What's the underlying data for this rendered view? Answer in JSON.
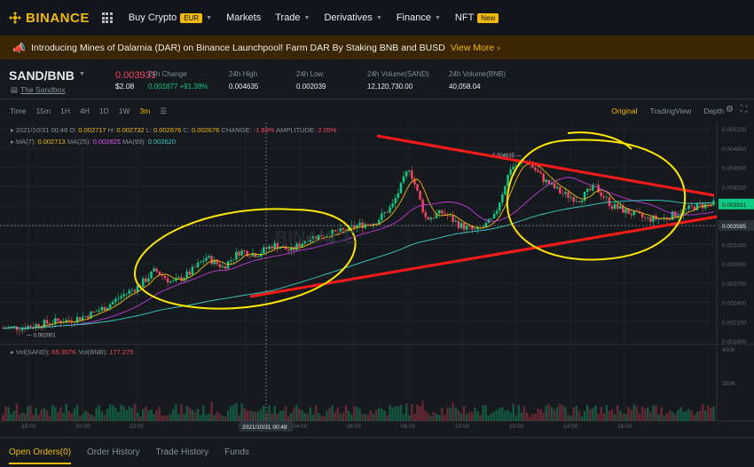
{
  "nav": {
    "brand": "BINANCE",
    "items": [
      {
        "label": "Buy Crypto",
        "badge": "EUR",
        "caret": true
      },
      {
        "label": "Markets",
        "badge": "",
        "caret": false
      },
      {
        "label": "Trade",
        "badge": "",
        "caret": true
      },
      {
        "label": "Derivatives",
        "badge": "",
        "caret": true
      },
      {
        "label": "Finance",
        "badge": "",
        "caret": true
      },
      {
        "label": "NFT",
        "badge": "New",
        "caret": false
      }
    ]
  },
  "announcement": {
    "text": "Introducing Mines of Dalarnia (DAR) on Binance Launchpool! Farm DAR By Staking BNB and BUSD",
    "link": "View More",
    "link_icon": "chevron-right-icon"
  },
  "ticker": {
    "pair": "SAND/BNB",
    "project": "The Sandbox",
    "last_price": "0.003931",
    "usd_price": "$2.08",
    "stats": [
      {
        "label": "24h Change",
        "value": "0.001877 +91.38%",
        "color": "#0ecb81"
      },
      {
        "label": "24h High",
        "value": "0.004635",
        "color": "#eaecef"
      },
      {
        "label": "24h Low",
        "value": "0.002039",
        "color": "#eaecef"
      },
      {
        "label": "24h Volume(SAND)",
        "value": "12,120,730.00",
        "color": "#eaecef"
      },
      {
        "label": "24h Volume(BNB)",
        "value": "40,058.04",
        "color": "#eaecef"
      }
    ]
  },
  "toolbar": {
    "timeframes": [
      "Time",
      "15m",
      "1H",
      "4H",
      "1D",
      "1W",
      "3m"
    ],
    "active_timeframe": "3m",
    "views": [
      "Original",
      "TradingView",
      "Depth"
    ],
    "active_view": "Original"
  },
  "legend": {
    "ohlc": {
      "date": "2021/10/31 00:48",
      "O": "0.002717",
      "H": "0.002732",
      "L": "0.002676",
      "C": "0.002676",
      "change": "-1.83%",
      "amplitude": "2.05%"
    },
    "ma": {
      "ma7": "0.002713",
      "ma25": "0.002825",
      "ma99": "0.002620"
    },
    "vol": {
      "sand": "65.357K",
      "bnb": "177.275"
    }
  },
  "chart_data": {
    "type": "candlestick",
    "pair": "SAND/BNB",
    "y_ticks": [
      "0.005100",
      "0.004800",
      "0.004500",
      "0.004200",
      "0.003900",
      "0.003600",
      "0.003300",
      "0.003000",
      "0.002700",
      "0.002400",
      "0.002100",
      "0.001800"
    ],
    "ylim": [
      0.0018,
      0.0052
    ],
    "x_ticks": [
      "18:00",
      "20:00",
      "22:00",
      "02:00",
      "04:00",
      "06:00",
      "08:00",
      "10:00",
      "12:00",
      "14:00",
      "16:00"
    ],
    "crosshair_x_label": "2021/10/31 00:48",
    "current_price_label": "0.003931",
    "crosshair_price_label": "0.003595",
    "high_marker": "0.004635",
    "low_marker": "0.002001",
    "volume_ticks": [
      "400K",
      "200K"
    ],
    "price_path": [
      0.002,
      0.00201,
      0.00205,
      0.0021,
      0.00212,
      0.0022,
      0.00232,
      0.0025,
      0.00265,
      0.0029,
      0.0027,
      0.00285,
      0.0031,
      0.00295,
      0.0032,
      0.00315,
      0.0033,
      0.0032,
      0.0034,
      0.00345,
      0.0035,
      0.0036,
      0.00365,
      0.0039,
      0.0045,
      0.0037,
      0.0038,
      0.0036,
      0.0035,
      0.0037,
      0.0045,
      0.0046,
      0.0043,
      0.0041,
      0.004,
      0.0042,
      0.0039,
      0.0038,
      0.0037,
      0.0037,
      0.0038,
      0.0039,
      0.00393
    ],
    "colors": {
      "up": "#0ecb81",
      "down": "#f6465d",
      "ma7": "#f0b90b",
      "ma25": "#c33bd9",
      "ma99": "#38d0c8",
      "annotation_yellow": "#ffe600",
      "annotation_red": "#ff1a1a"
    }
  },
  "bottom_tabs": [
    "Open Orders(0)",
    "Order History",
    "Trade History",
    "Funds"
  ],
  "active_bottom_tab": "Open Orders(0)"
}
